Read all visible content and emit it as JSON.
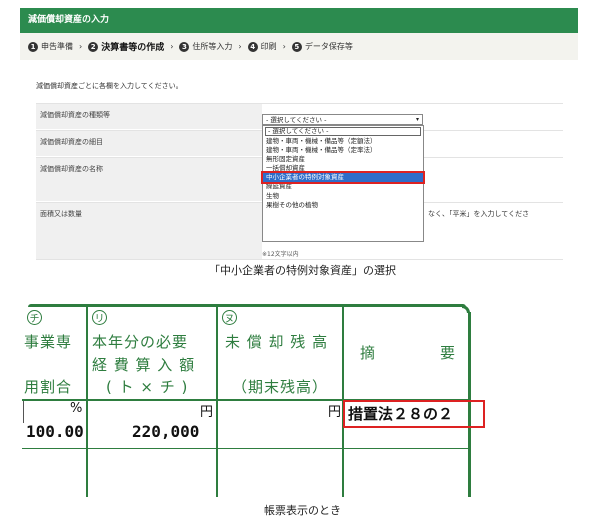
{
  "screen": {
    "title": "減価償却資産の入力",
    "steps": [
      {
        "num": "1",
        "label": "申告準備"
      },
      {
        "num": "2",
        "label": "決算書等の作成"
      },
      {
        "num": "3",
        "label": "住所等入力"
      },
      {
        "num": "4",
        "label": "印刷"
      },
      {
        "num": "5",
        "label": "データ保存等"
      }
    ],
    "active_step": 1,
    "instruction": "減価償却資産ごとに各欄を入力してください。",
    "fields": [
      {
        "label": "減価償却資産の種類等"
      },
      {
        "label": "減価償却資産の細目"
      },
      {
        "label": "減価償却資産の名称"
      },
      {
        "label": "面積又は数量"
      }
    ],
    "select_value": "- 選択してください -",
    "dropdown_options": [
      "- 選択してください -",
      "建物・車両・機械・備品等（定額法）",
      "建物・車両・機械・備品等（定率法）",
      "無形固定資産",
      "一括償却資産",
      "中小企業者の特例対象資産",
      "繰延資産",
      "生物",
      "果樹その他の植物"
    ],
    "selected_index": 5,
    "area_hint": "なく、「平米」を入力してくださ",
    "char_limit": "※12文字以内",
    "accent_green": "#2c8b4f"
  },
  "caption_top": "「中小企業者の特例対象資産」の選択",
  "ledger": {
    "col1": {
      "mark": "チ",
      "line1": "事業専",
      "line2": "用割合",
      "unit": "%",
      "value": "100.00"
    },
    "col2": {
      "mark": "リ",
      "line1": "本年分の必要",
      "line2": "経 費 算 入 額",
      "line3": "( ト × チ )",
      "unit": "円",
      "value": "220,000"
    },
    "col3": {
      "mark": "ヌ",
      "line1": "未 償 却 残 高",
      "line2": "（期末残高）",
      "unit": "円"
    },
    "col4": {
      "line1": "摘　　　　要"
    },
    "remark": "措置法２８の２",
    "frame_green": "#2e7d3f",
    "highlight_red": "#dd2222"
  },
  "caption_bottom": "帳票表示のとき"
}
